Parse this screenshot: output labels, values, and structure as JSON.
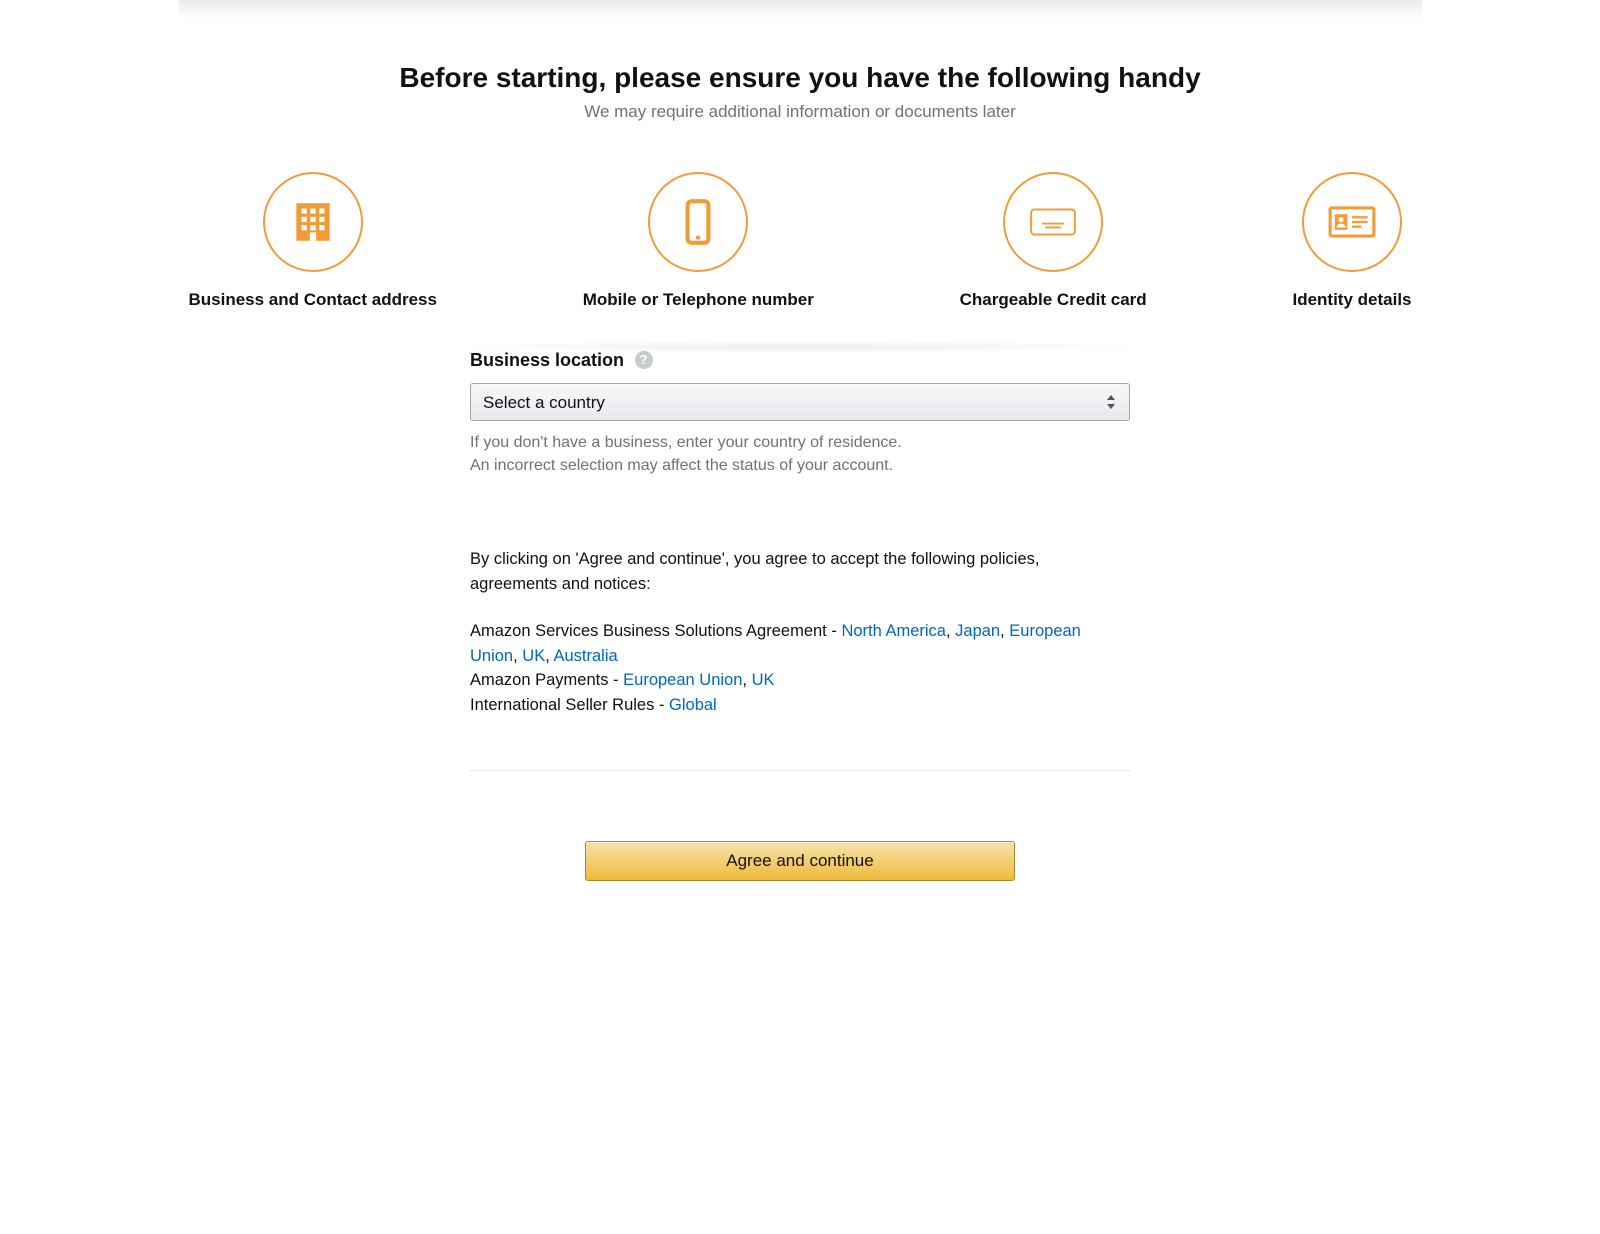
{
  "heading": {
    "title": "Before starting, please ensure you have the following handy",
    "subtitle": "We may require additional information or documents later"
  },
  "requirements": [
    {
      "label": "Business and Contact address",
      "icon": "building-icon"
    },
    {
      "label": "Mobile or Telephone number",
      "icon": "phone-icon"
    },
    {
      "label": "Chargeable Credit card",
      "icon": "credit-card-icon"
    },
    {
      "label": "Identity details",
      "icon": "id-card-icon"
    }
  ],
  "business_location": {
    "label": "Business location",
    "help_glyph": "?",
    "selected": "Select a country",
    "hint_line1": "If you don't have a business, enter your country of residence.",
    "hint_line2": "An incorrect selection may affect the status of your account."
  },
  "policies": {
    "intro": "By clicking on 'Agree and continue', you agree to accept the following policies, agreements and notices:",
    "agreements": {
      "business_solutions": {
        "prefix": "Amazon Services Business Solutions Agreement - ",
        "links": [
          {
            "text": "North America"
          },
          {
            "text": "Japan"
          },
          {
            "text": "European Union"
          },
          {
            "text": "UK"
          },
          {
            "text": "Australia"
          }
        ]
      },
      "payments": {
        "prefix": "Amazon Payments - ",
        "links": [
          {
            "text": "European Union"
          },
          {
            "text": "UK"
          }
        ]
      },
      "intl_rules": {
        "prefix": "International Seller Rules - ",
        "links": [
          {
            "text": "Global"
          }
        ]
      }
    }
  },
  "cta": {
    "agree_label": "Agree and continue"
  },
  "colors": {
    "accent": "#f29c38",
    "link": "#0066c0"
  }
}
